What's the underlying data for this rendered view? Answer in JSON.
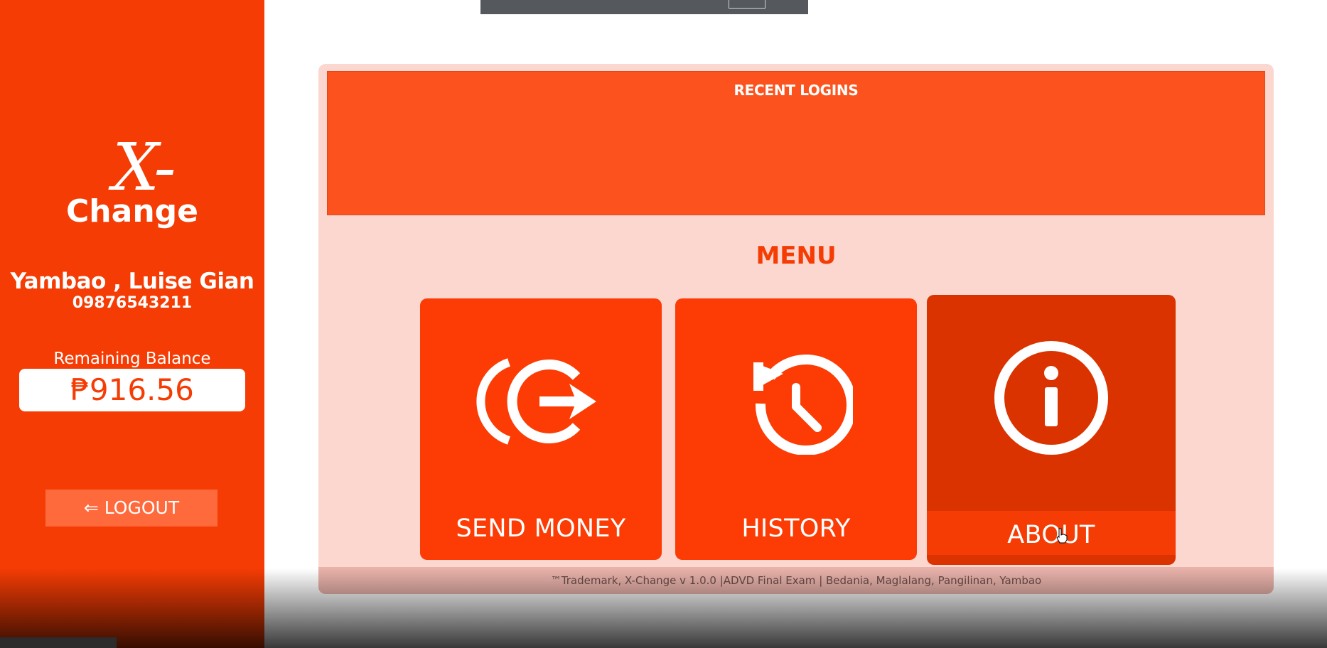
{
  "app": {
    "brand_mark": "X-",
    "brand_name": "Change"
  },
  "sidebar": {
    "user_name": "Yambao , Luise Gian",
    "user_phone": "09876543211",
    "balance_label": "Remaining Balance",
    "balance_value": "₱916.56",
    "logout_label": "⇐ LOGOUT"
  },
  "main": {
    "recent_logins_title": "RECENT LOGINS",
    "menu_title": "MENU",
    "tiles": [
      {
        "label": "SEND MONEY",
        "icon": "send-money-icon"
      },
      {
        "label": "HISTORY",
        "icon": "history-icon"
      },
      {
        "label": "ABOUT",
        "icon": "info-icon"
      }
    ],
    "footer": "™Trademark, X-Change v 1.0.0 |ADVD Final Exam | Bedania, Maglalang, Pangilinan, Yambao"
  },
  "colors": {
    "primary": "#f53c04",
    "panel_bg": "#fbd7d0",
    "recent_bg": "#fc531e",
    "tile_hover": "#db3300"
  }
}
